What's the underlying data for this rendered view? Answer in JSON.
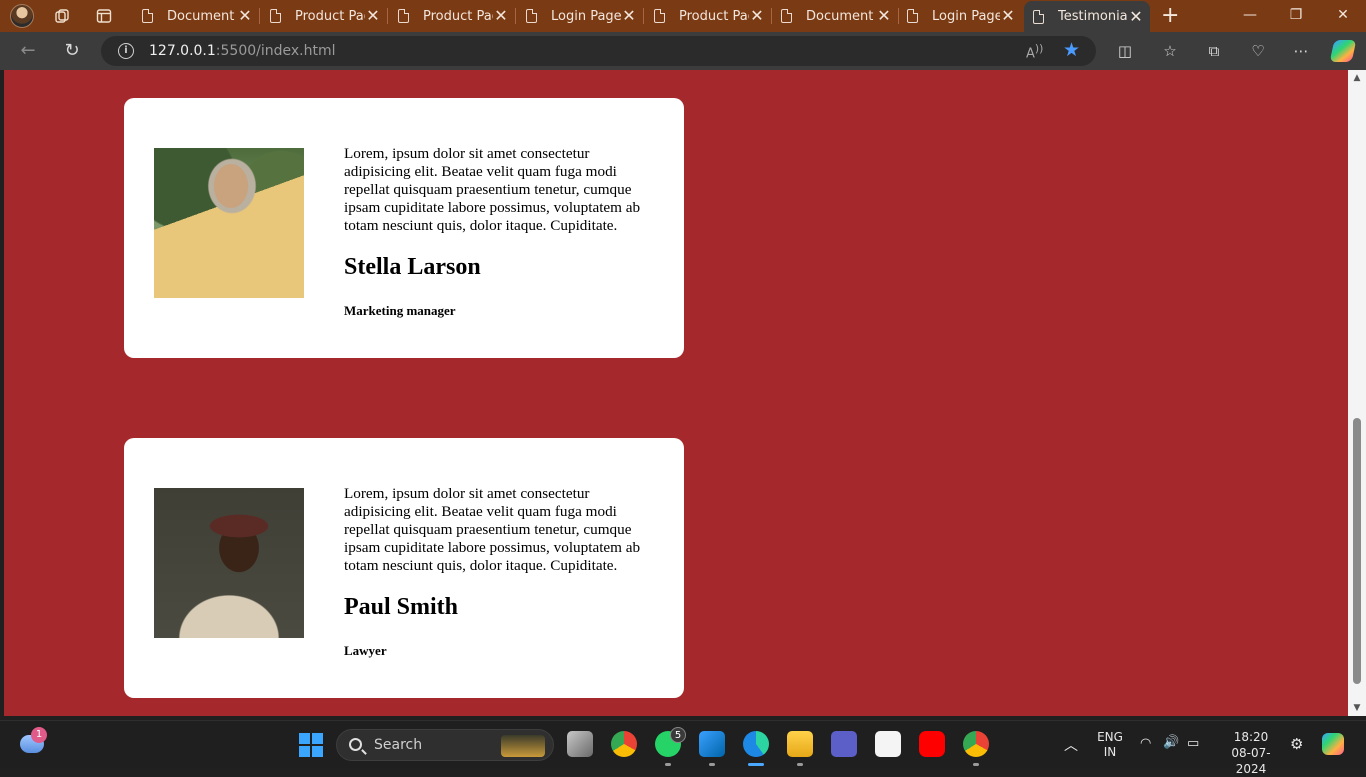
{
  "browser": {
    "tabs": [
      {
        "label": "Document",
        "active": false
      },
      {
        "label": "Product Pag",
        "active": false
      },
      {
        "label": "Product Pag",
        "active": false
      },
      {
        "label": "Login Page",
        "active": false
      },
      {
        "label": "Product Pag",
        "active": false
      },
      {
        "label": "Document",
        "active": false
      },
      {
        "label": "Login Page",
        "active": false
      },
      {
        "label": "Testimonial",
        "active": true
      }
    ],
    "url_host": "127.0.0.1",
    "url_rest": ":5500/index.html",
    "accent_color": "#4a9bff"
  },
  "page": {
    "background_color": "#a5292c",
    "testimonials": [
      {
        "quote": "Lorem, ipsum dolor sit amet consectetur adipisicing elit. Beatae velit quam fuga modi repellat quisquam praesentium tenetur, cumque ipsam cupiditate labore possimus, voluptatem ab totam nesciunt quis, dolor itaque. Cupiditate.",
        "name": "Stella Larson",
        "role": "Marketing manager"
      },
      {
        "quote": "Lorem, ipsum dolor sit amet consectetur adipisicing elit. Beatae velit quam fuga modi repellat quisquam praesentium tenetur, cumque ipsam cupiditate labore possimus, voluptatem ab totam nesciunt quis, dolor itaque. Cupiditate.",
        "name": "Paul Smith",
        "role": "Lawyer"
      }
    ]
  },
  "taskbar": {
    "weather_badge": "1",
    "search_label": "Search",
    "whatsapp_badge": "5",
    "language": "ENG",
    "region": "IN",
    "time": "18:20",
    "date": "08-07-2024"
  }
}
